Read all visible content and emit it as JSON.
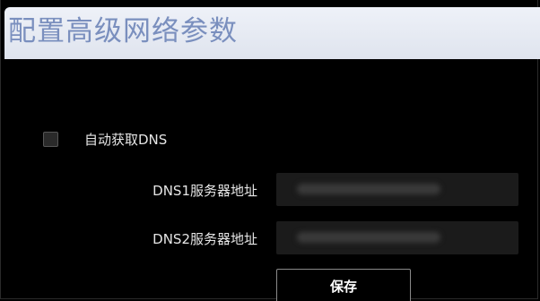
{
  "dialog": {
    "title": "配置高级网络参数"
  },
  "auto_dns": {
    "label": "自动获取DNS",
    "checked": false
  },
  "dns1": {
    "label": "DNS1服务器地址",
    "value": ""
  },
  "dns2": {
    "label": "DNS2服务器地址",
    "value": ""
  },
  "actions": {
    "save_label": "保存"
  },
  "colors": {
    "background": "#000000",
    "title_bar": "#e6eaf3",
    "title_text": "#7a8fbe",
    "label_text": "#e6e6e6",
    "input_background": "#1b1b1b",
    "button_border": "#8a8a8a"
  }
}
